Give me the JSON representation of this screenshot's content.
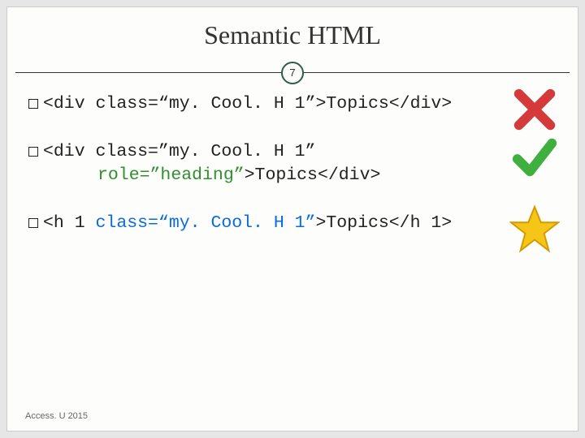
{
  "title": "Semantic HTML",
  "page_number": "7",
  "examples": [
    {
      "prefix": "<div class=",
      "quoted_attr": "“my. Cool. H 1”",
      "mid": ">Topics</div>",
      "indent_prefix": "",
      "indent_hl": "",
      "indent_rest": "",
      "has_indent": false,
      "mark": "x",
      "hl_class": ""
    },
    {
      "prefix": "<div class=”my. Cool. H 1”",
      "quoted_attr": "",
      "mid": "",
      "indent_prefix": "",
      "indent_hl": "role=”heading”",
      "indent_rest": ">Topics</div>",
      "has_indent": true,
      "mark": "check",
      "hl_class": "hlr"
    },
    {
      "prefix": "<h 1 ",
      "quoted_attr": "class=“my. Cool. H 1”",
      "mid": ">Topics</h 1>",
      "indent_prefix": "",
      "indent_hl": "",
      "indent_rest": "",
      "has_indent": false,
      "mark": "star",
      "hl_class": "hlc"
    }
  ],
  "footer": "Access. U 2015"
}
